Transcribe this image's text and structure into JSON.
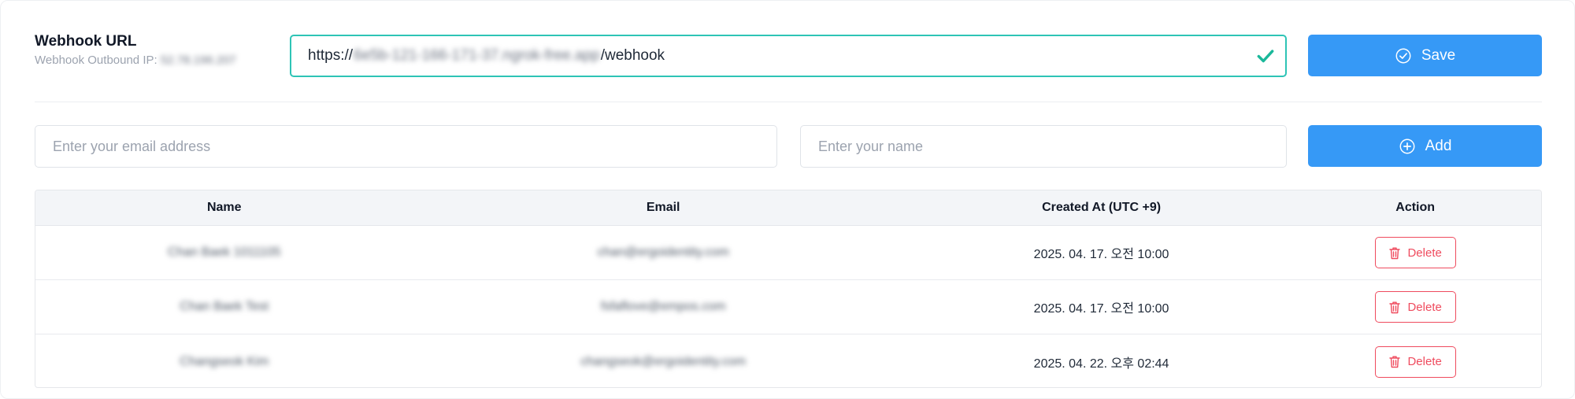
{
  "webhook": {
    "title": "Webhook URL",
    "outbound_ip_label": "Webhook Outbound IP:",
    "outbound_ip_value": "52.78.196.207",
    "url_prefix": "https://",
    "url_hidden": "6e5b-121-166-171-37.ngrok-free.app",
    "url_suffix": "/webhook",
    "status_icon": "check-icon",
    "save_label": "Save",
    "accent_color": "#2ec4b6"
  },
  "add_form": {
    "email_placeholder": "Enter your email address",
    "name_placeholder": "Enter your name",
    "add_label": "Add"
  },
  "table": {
    "headers": [
      "Name",
      "Email",
      "Created At (UTC +9)",
      "Action"
    ],
    "rows": [
      {
        "name": "Chan Baek 1011105",
        "email": "chan@ergoidentity.com",
        "created_at": "2025. 04. 17. 오전 10:00",
        "action": "Delete"
      },
      {
        "name": "Chan Baek Test",
        "email": "fsfaflove@empos.com",
        "created_at": "2025. 04. 17. 오전 10:00",
        "action": "Delete"
      },
      {
        "name": "Changseok Kim",
        "email": "changseok@ergoidentity.com",
        "created_at": "2025. 04. 22. 오후 02:44",
        "action": "Delete"
      }
    ]
  },
  "colors": {
    "primary": "#3699f6",
    "danger": "#ef4b5e",
    "success": "#2ec4b6"
  }
}
